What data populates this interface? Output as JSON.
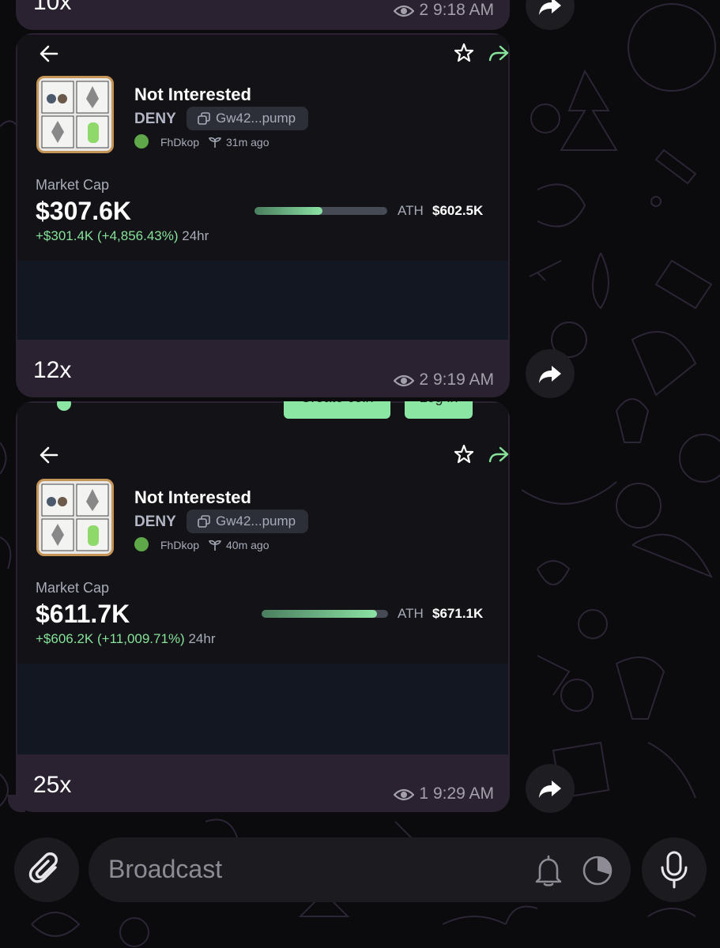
{
  "messages": [
    {
      "caption": "10x",
      "views": "2",
      "time": "9:18 AM"
    },
    {
      "token": {
        "name": "Not Interested",
        "ticker": "DENY",
        "contract": "Gw42...pump",
        "creator": "FhDkop",
        "age": "31m ago"
      },
      "market_cap_label": "Market Cap",
      "market_cap": "$307.6K",
      "change": "+$301.4K (+4,856.43%)",
      "change_period": "24hr",
      "ath_label": "ATH",
      "ath_value": "$602.5K",
      "progress_fraction": 0.51,
      "caption": "12x",
      "views": "2",
      "time": "9:19 AM"
    },
    {
      "header_buttons": [
        "Create coin",
        "Log in"
      ],
      "token": {
        "name": "Not Interested",
        "ticker": "DENY",
        "contract": "Gw42...pump",
        "creator": "FhDkop",
        "age": "40m ago"
      },
      "market_cap_label": "Market Cap",
      "market_cap": "$611.7K",
      "change": "+$606.2K (+11,009.71%)",
      "change_period": "24hr",
      "ath_label": "ATH",
      "ath_value": "$671.1K",
      "progress_fraction": 0.91,
      "caption": "25x",
      "views": "1",
      "time": "9:29 AM"
    }
  ],
  "composer": {
    "placeholder": "Broadcast"
  },
  "colors": {
    "accent_green": "#86e399",
    "bubble": "#2a2230",
    "card": "#121217"
  },
  "icons": [
    "back-arrow-icon",
    "star-icon",
    "share-icon",
    "copy-icon",
    "sprout-icon",
    "eye-icon",
    "forward-icon",
    "paperclip-icon",
    "bell-icon",
    "timer-icon",
    "microphone-icon"
  ]
}
